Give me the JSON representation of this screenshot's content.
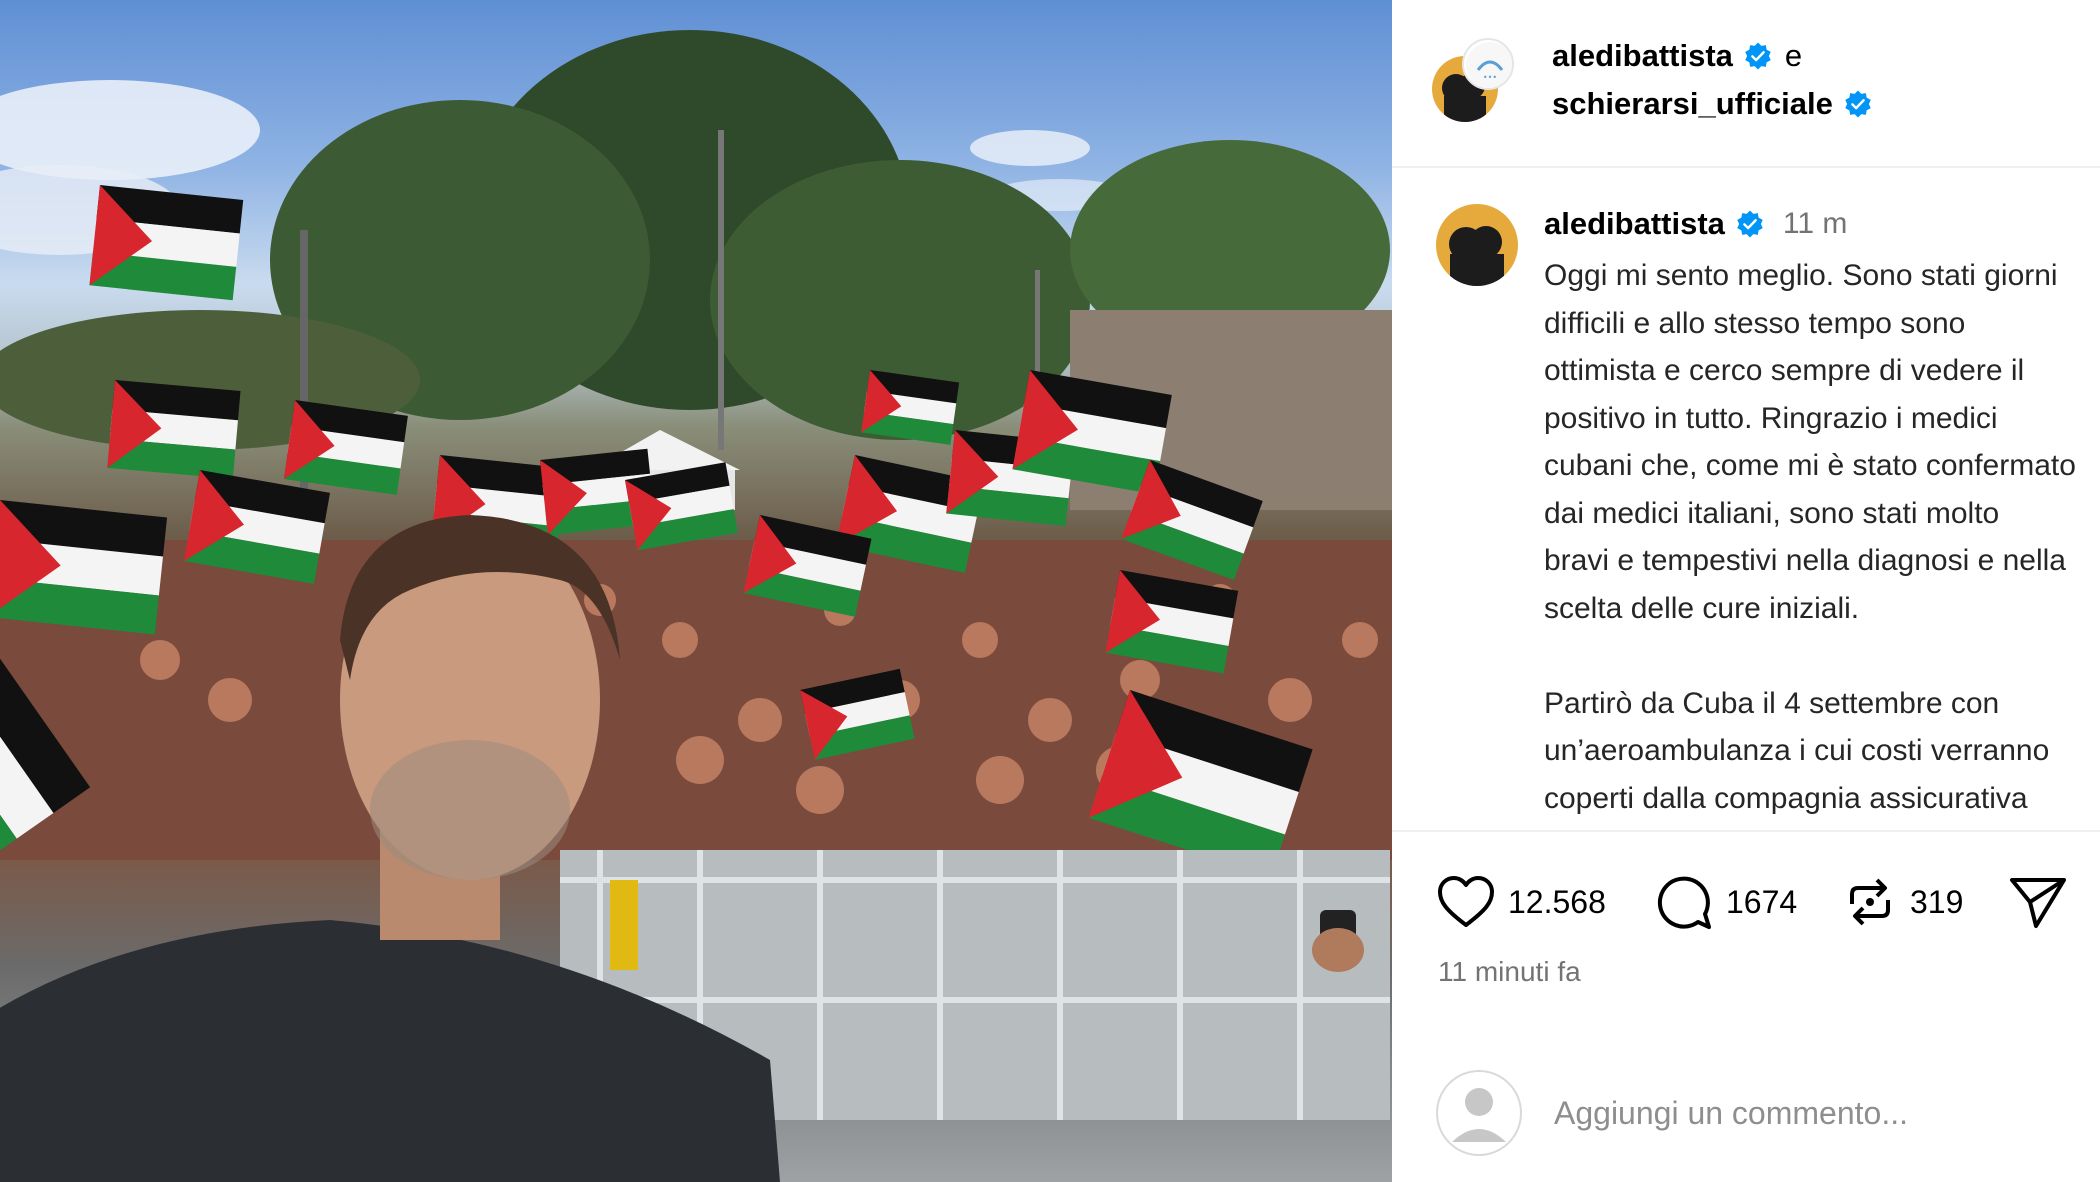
{
  "header": {
    "user1": "aledibattista",
    "connector": "e",
    "user2": "schierarsi_ufficiale"
  },
  "post": {
    "username": "aledibattista",
    "time": "11 m",
    "caption": "Oggi mi sento meglio. Sono stati giorni\ndifficili e allo stesso tempo sono\nottimista e cerco sempre di vedere il\npositivo in tutto. Ringrazio i medici\ncubani che, come mi è stato confermato\ndai medici italiani, sono stati molto\nbravi e tempestivi nella diagnosi e nella\nscelta delle cure iniziali.\n\nPartirò da Cuba il 4 settembre con\nun’aeroambulanza i cui costi verranno\ncoperti dalla compagnia assicurativa"
  },
  "actions": {
    "likes": "12.568",
    "comments": "1674",
    "reposts": "319"
  },
  "timestamp": "11 minuti fa",
  "comment_box": {
    "placeholder": "Aggiungi un commento..."
  },
  "icons": {
    "like": "heart-icon",
    "comment": "comment-bubble-icon",
    "repost": "repost-icon",
    "share": "send-icon",
    "verified": "verified-badge-icon"
  },
  "colors": {
    "verified": "#0095f6",
    "secondary_text": "#737373",
    "divider": "#efefef"
  }
}
